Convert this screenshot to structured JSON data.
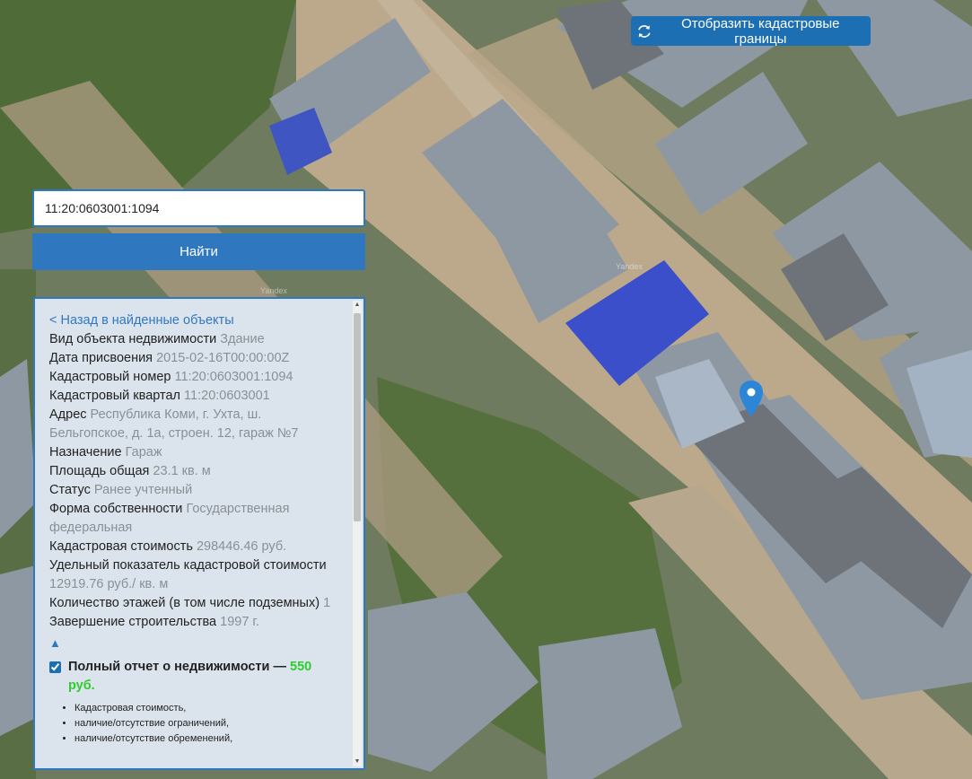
{
  "map": {
    "watermark": "Yandex",
    "colors": {
      "ground": "#6b7a5c",
      "road": "#bfae92",
      "roof_gray": "#8e98a3",
      "roof_blue": "#3a4fc7",
      "grass": "#4d6a36"
    }
  },
  "toolbar": {
    "cadastral_button_label": "Отобразить кадастровые границы",
    "refresh_icon": "refresh-icon"
  },
  "search": {
    "value": "11:20:0603001:1094",
    "find_label": "Найти"
  },
  "details": {
    "back_link": "< Назад в найденные объекты",
    "fields": [
      {
        "label": "Вид объекта недвижимости",
        "value": "Здание"
      },
      {
        "label": "Дата присвоения",
        "value": "2015-02-16T00:00:00Z"
      },
      {
        "label": "Кадастровый номер",
        "value": "11:20:0603001:1094"
      },
      {
        "label": "Кадастровый квартал",
        "value": "11:20:0603001"
      },
      {
        "label": "Адрес",
        "value": "Республика Коми, г. Ухта, ш. Бельгопское, д. 1а, строен. 12, гараж №7"
      },
      {
        "label": "Назначение",
        "value": "Гараж"
      },
      {
        "label": "Площадь общая",
        "value": "23.1 кв. м"
      },
      {
        "label": "Статус",
        "value": "Ранее учтенный"
      },
      {
        "label": "Форма собственности",
        "value": "Государственная федеральная"
      },
      {
        "label": "Кадастровая стоимость",
        "value": "298446.46 руб."
      },
      {
        "label": "Удельный показатель кадастровой стоимости",
        "value": "12919.76 руб./ кв. м"
      },
      {
        "label": "Количество этажей (в том числе подземных)",
        "value": "1"
      },
      {
        "label": "Завершение строительства",
        "value": "1997 г."
      }
    ],
    "collapse_icon": "▲",
    "report": {
      "checked": true,
      "title": "Полный отчет о недвижимости — ",
      "price": "550 руб.",
      "items": [
        "Кадастровая стоимость,",
        "наличие/отсутствие ограничений,",
        "наличие/отсутствие обременений,"
      ]
    }
  }
}
